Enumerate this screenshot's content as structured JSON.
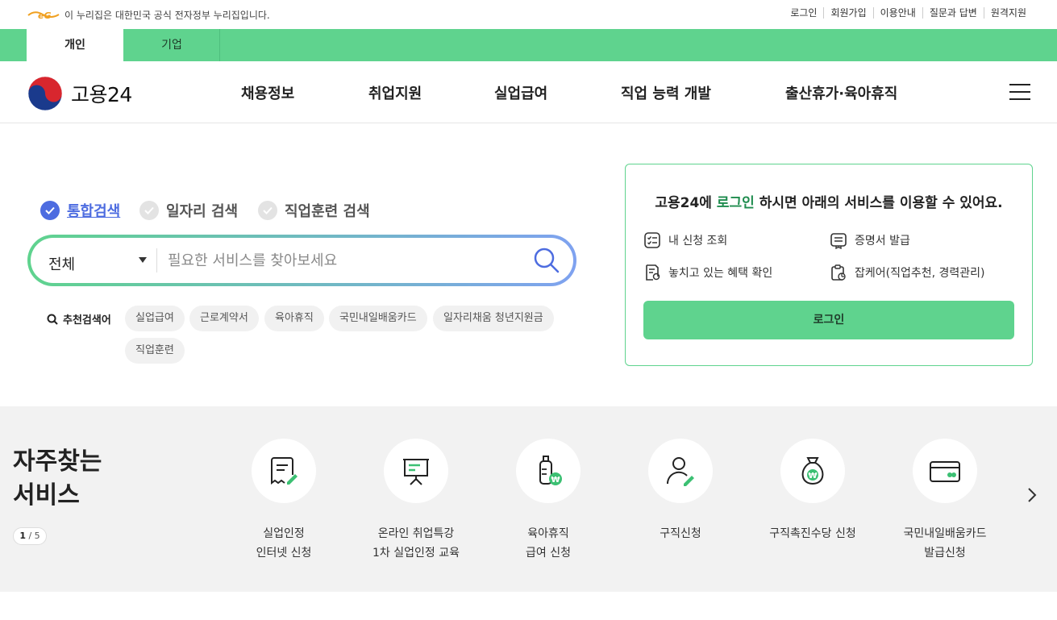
{
  "gov_banner": {
    "logo_text": "eG",
    "text": "이 누리집은 대한민국 공식 전자정부 누리집입니다.",
    "links": [
      "로그인",
      "회원가입",
      "이용안내",
      "질문과 답변",
      "원격지원"
    ]
  },
  "tabs": [
    {
      "label": "개인",
      "active": true
    },
    {
      "label": "기업",
      "active": false
    }
  ],
  "header": {
    "brand": "고용24",
    "nav": [
      "채용정보",
      "취업지원",
      "실업급여",
      "직업 능력 개발",
      "출산휴가·육아휴직"
    ]
  },
  "search": {
    "types": [
      {
        "label": "통합검색",
        "active": true
      },
      {
        "label": "일자리 검색",
        "active": false
      },
      {
        "label": "직업훈련 검색",
        "active": false
      }
    ],
    "scope": "전체",
    "placeholder": "필요한 서비스를 찾아보세요",
    "recommend_label": "추천검색어",
    "chips": [
      "실업급여",
      "근로계약서",
      "육아휴직",
      "국민내일배움카드",
      "일자리채움 청년지원금",
      "직업훈련"
    ]
  },
  "login_card": {
    "msg_prefix": "고용24에 ",
    "msg_highlight": "로그인",
    "msg_suffix": " 하시면 아래의 서비스를 이용할 수 있어요.",
    "services": [
      "내 신청 조회",
      "증명서 발급",
      "놓치고 있는 혜택 확인",
      "잡케어(직업추천, 경력관리)"
    ],
    "button": "로그인"
  },
  "frequent": {
    "title_line1": "자주찾는",
    "title_line2": "서비스",
    "page_current": "1",
    "page_sep": " / ",
    "page_total": "5",
    "items": [
      {
        "line1": "실업인정",
        "line2": "인터넷 신청",
        "icon": "document-pen-icon"
      },
      {
        "line1": "온라인 취업특강",
        "line2": "1차 실업인정 교육",
        "icon": "presentation-board-icon"
      },
      {
        "line1": "육아휴직",
        "line2": "급여 신청",
        "icon": "baby-bottle-won-icon"
      },
      {
        "line1": "구직신청",
        "line2": "",
        "icon": "person-pen-icon"
      },
      {
        "line1": "구직촉진수당 신청",
        "line2": "",
        "icon": "money-bag-won-icon"
      },
      {
        "line1": "국민내일배움카드",
        "line2": "발급신청",
        "icon": "card-icon"
      }
    ]
  },
  "colors": {
    "brand_green": "#5fd38e",
    "accent_blue": "#4d6ce0",
    "highlight_green": "#1f8c4e"
  }
}
